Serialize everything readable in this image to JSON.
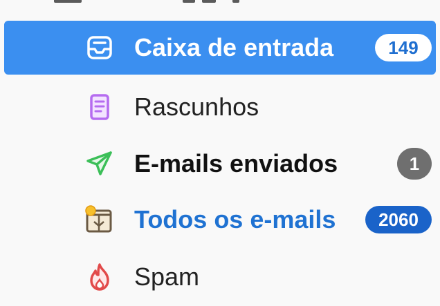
{
  "folders": [
    {
      "label": "Caixa de entrada",
      "icon": "inbox-icon",
      "badge": "149"
    },
    {
      "label": "Rascunhos",
      "icon": "drafts-icon",
      "badge": ""
    },
    {
      "label": "E-mails enviados",
      "icon": "sent-icon",
      "badge": "1"
    },
    {
      "label": "Todos os e-mails",
      "icon": "all-mail-icon",
      "badge": "2060"
    },
    {
      "label": "Spam",
      "icon": "spam-icon",
      "badge": ""
    }
  ],
  "colors": {
    "selected_bg": "#3b8ff0",
    "link_blue": "#1f72d2",
    "badge_gray": "#6f6f6f",
    "badge_blue": "#1a63c9"
  }
}
